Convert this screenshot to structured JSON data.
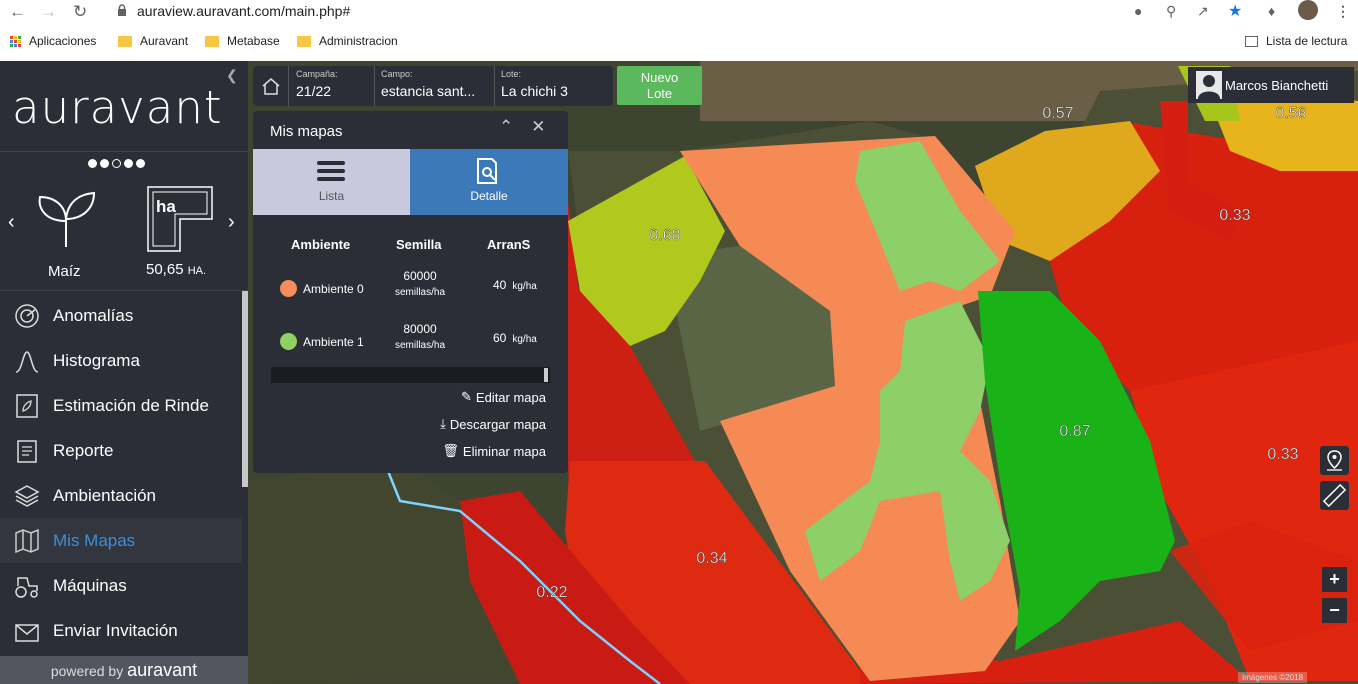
{
  "browser": {
    "url": "auraview.auravant.com/main.php#",
    "bookmarks": [
      "Aplicaciones",
      "Auravant",
      "Metabase",
      "Administracion"
    ],
    "reading_list": "Lista de lectura"
  },
  "sidebar": {
    "logo": "auravant",
    "crop": "Maíz",
    "area_value": "50,65",
    "area_unit": "HA.",
    "area_icon_label": "ha",
    "menu": [
      {
        "label": "Anomalías",
        "icon": "radar-icon"
      },
      {
        "label": "Histograma",
        "icon": "histogram-icon"
      },
      {
        "label": "Estimación de Rinde",
        "icon": "yield-icon"
      },
      {
        "label": "Reporte",
        "icon": "report-icon"
      },
      {
        "label": "Ambientación",
        "icon": "layers-icon"
      },
      {
        "label": "Mis Mapas",
        "icon": "map-icon",
        "active": true
      },
      {
        "label": "Máquinas",
        "icon": "tractor-icon"
      },
      {
        "label": "Enviar Invitación",
        "icon": "mail-icon"
      }
    ],
    "powered": "powered by",
    "powered_brand": "auravant"
  },
  "breadcrumb": {
    "campana_label": "Campaña:",
    "campana": "21/22",
    "campo_label": "Campo:",
    "campo": "estancia sant...",
    "lote_label": "Lote:",
    "lote": "La chichi 3"
  },
  "nuevo_lote": {
    "line1": "Nuevo",
    "line2": "Lote"
  },
  "user": {
    "name": "Marcos Bianchetti"
  },
  "panel": {
    "title": "Mis mapas",
    "tab_list": "Lista",
    "tab_detail": "Detalle",
    "headers": [
      "Ambiente",
      "Semilla",
      "ArranS"
    ],
    "rows": [
      {
        "name": "Ambiente 0",
        "color": "#f58e5b",
        "seed": "60000",
        "seed_unit": "semillas/ha",
        "arr": "40",
        "arr_unit": "kg/ha"
      },
      {
        "name": "Ambiente 1",
        "color": "#8fd063",
        "seed": "80000",
        "seed_unit": "semillas/ha",
        "arr": "60",
        "arr_unit": "kg/ha"
      }
    ],
    "actions": [
      "Editar mapa",
      "Descargar mapa",
      "Eliminar mapa"
    ]
  },
  "map_labels": [
    "0.57",
    "0.56",
    "0.68",
    "0.33",
    "0.87",
    "0.33",
    "0.34",
    "0.22"
  ],
  "colors": {
    "sidebar": "#2b2d37",
    "accent": "#3d8fd8",
    "green_btn": "#5cb85c"
  }
}
